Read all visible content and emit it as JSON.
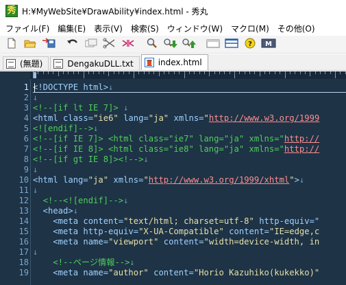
{
  "window": {
    "title": "H:¥MyWebSite¥DrawAbility¥index.html  - 秀丸",
    "app_icon_char": "秀"
  },
  "menu": [
    {
      "key": "file",
      "label": "ファイル(F)"
    },
    {
      "key": "edit",
      "label": "編集(E)"
    },
    {
      "key": "view",
      "label": "表示(V)"
    },
    {
      "key": "search",
      "label": "検索(S)"
    },
    {
      "key": "window",
      "label": "ウィンドウ(W)"
    },
    {
      "key": "macro",
      "label": "マクロ(M)"
    },
    {
      "key": "other",
      "label": "その他(O)"
    }
  ],
  "toolbar": [
    {
      "name": "new-file-icon"
    },
    {
      "name": "open-folder-icon"
    },
    {
      "name": "save-icon"
    },
    {
      "name": "undo-icon"
    },
    {
      "name": "copy-icon"
    },
    {
      "name": "cut-icon"
    },
    {
      "name": "paste-icon"
    },
    {
      "name": "search-icon"
    },
    {
      "name": "search-down-icon"
    },
    {
      "name": "search-up-icon"
    },
    {
      "name": "window-icon"
    },
    {
      "name": "split-window-icon"
    },
    {
      "name": "help-icon"
    },
    {
      "name": "macro-icon"
    }
  ],
  "tabs": [
    {
      "label": "(無題)",
      "active": false
    },
    {
      "label": "DengakuDLL.txt",
      "active": false
    },
    {
      "label": "index.html",
      "active": true
    }
  ],
  "editor": {
    "colors": {
      "background": "#1e3346",
      "tag": "#9fd1ff",
      "comment": "#4fce5a",
      "string": "#e6e0a8",
      "url": "#ff8e8e",
      "line_number": "#7aa7cf"
    },
    "lines": [
      {
        "no": "1",
        "tokens": [
          [
            "tag",
            "<!DOCTYPE html>"
          ],
          [
            "ret",
            "↓"
          ]
        ]
      },
      {
        "no": "2",
        "tokens": [
          [
            "ret",
            "↓"
          ]
        ]
      },
      {
        "no": "3",
        "tokens": [
          [
            "cmt",
            "<!--[if lt IE 7]> "
          ],
          [
            "ret",
            "↓"
          ]
        ]
      },
      {
        "no": "4",
        "tokens": [
          [
            "tag",
            "<html class="
          ],
          [
            "str",
            "\"ie6\""
          ],
          [
            "tag",
            " lang="
          ],
          [
            "str",
            "\"ja\""
          ],
          [
            "tag",
            " xmlns="
          ],
          [
            "str",
            "\""
          ],
          [
            "url",
            "http://www.w3.org/1999"
          ]
        ]
      },
      {
        "no": "5",
        "tokens": [
          [
            "cmt",
            "<![endif]-->"
          ],
          [
            "ret",
            "↓"
          ]
        ]
      },
      {
        "no": "6",
        "tokens": [
          [
            "cmt",
            "<!--[if IE 7]> <html class=\"ie7\" lang=\"ja\" xmlns=\""
          ],
          [
            "url",
            "http://"
          ]
        ]
      },
      {
        "no": "7",
        "tokens": [
          [
            "cmt",
            "<!--[if IE 8]> <html class=\"ie8\" lang=\"ja\" xmlns=\""
          ],
          [
            "url",
            "http://"
          ]
        ]
      },
      {
        "no": "8",
        "tokens": [
          [
            "cmt",
            "<!--[if gt IE 8]><!-->"
          ],
          [
            "ret",
            "↓"
          ]
        ]
      },
      {
        "no": "9",
        "tokens": [
          [
            "ret",
            "↓"
          ]
        ]
      },
      {
        "no": "10",
        "tokens": [
          [
            "tag",
            "<html lang="
          ],
          [
            "str",
            "\"ja\""
          ],
          [
            "tag",
            " xmlns="
          ],
          [
            "str",
            "\""
          ],
          [
            "url",
            "http://www.w3.org/1999/xhtml"
          ],
          [
            "str",
            "\""
          ],
          [
            "tag",
            ">"
          ],
          [
            "ret",
            "↓"
          ]
        ]
      },
      {
        "no": "11",
        "tokens": [
          [
            "ret",
            "↓"
          ]
        ]
      },
      {
        "no": "12",
        "tokens": [
          [
            "txt",
            "  "
          ],
          [
            "cmt",
            "<!--<![endif]-->"
          ],
          [
            "ret",
            "↓"
          ]
        ]
      },
      {
        "no": "13",
        "tokens": [
          [
            "tag",
            "  <head>"
          ],
          [
            "ret",
            "↓"
          ]
        ]
      },
      {
        "no": "14",
        "tokens": [
          [
            "tag",
            "    <meta content="
          ],
          [
            "str",
            "\"text/html; charset=utf-8\""
          ],
          [
            "tag",
            " http-equiv=\""
          ]
        ]
      },
      {
        "no": "15",
        "tokens": [
          [
            "tag",
            "    <meta http-equiv="
          ],
          [
            "str",
            "\"X-UA-Compatible\""
          ],
          [
            "tag",
            " content="
          ],
          [
            "str",
            "\"IE=edge,c"
          ]
        ]
      },
      {
        "no": "16",
        "tokens": [
          [
            "tag",
            "    <meta name="
          ],
          [
            "str",
            "\"viewport\""
          ],
          [
            "tag",
            " content="
          ],
          [
            "str",
            "\"width=device-width, in"
          ]
        ]
      },
      {
        "no": "17",
        "tokens": [
          [
            "ret",
            "↓"
          ]
        ]
      },
      {
        "no": "18",
        "tokens": [
          [
            "txt",
            "    "
          ],
          [
            "cmt",
            "<!--ページ情報-->"
          ],
          [
            "ret",
            "↓"
          ]
        ]
      },
      {
        "no": "19",
        "tokens": [
          [
            "tag",
            "    <meta name="
          ],
          [
            "str",
            "\"author\""
          ],
          [
            "tag",
            " content="
          ],
          [
            "str",
            "\"Horio Kazuhiko(kukekko)\""
          ]
        ]
      }
    ]
  }
}
